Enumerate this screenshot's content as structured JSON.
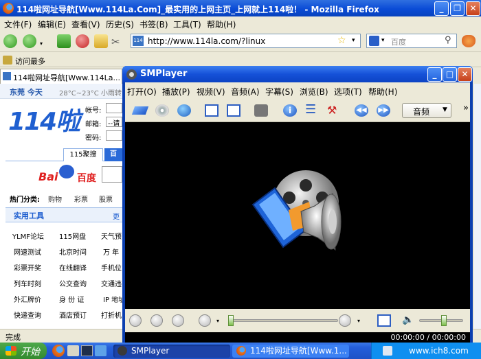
{
  "firefox": {
    "title": "114啦网址导航[Www.114La.Com]_最实用的上网主页_上网就上114啦！ - Mozilla Firefox",
    "menu": [
      "文件(F)",
      "编辑(E)",
      "查看(V)",
      "历史(S)",
      "书签(B)",
      "工具(T)",
      "帮助(H)"
    ],
    "url": "http://www.114la.com/?linux",
    "search_placeholder": "百度",
    "bookmark": "访问最多",
    "tab_title": "114啦网址导航[Www.114La...",
    "status": "完成"
  },
  "webpage": {
    "location": "东莞 今天",
    "weather": "28°C~23°C 小雨转",
    "logo": "114啦",
    "account_label": "帐号:",
    "email_label": "邮箱:",
    "email_value": "--请",
    "password_label": "密码:",
    "search_tab": "115聚搜",
    "search_tab2": "百",
    "baidu_logo": "Bai",
    "baidu_cn": "百度",
    "hot_label": "热门分类:",
    "hot_items": [
      "购物",
      "彩票",
      "股票"
    ],
    "tools_title": "实用工具",
    "tools_more": "更",
    "tools": [
      [
        "YLMF论坛",
        "115网盘",
        "天气预"
      ],
      [
        "网速测试",
        "北京时间",
        "万 年"
      ],
      [
        "彩票开奖",
        "在线翻译",
        "手机位"
      ],
      [
        "列车时刻",
        "公交查询",
        "交通违"
      ],
      [
        "外汇牌价",
        "身 份 证",
        "IP 地址"
      ],
      [
        "快递查询",
        "酒店预订",
        "打折机"
      ]
    ]
  },
  "smplayer": {
    "title": "SMPlayer",
    "menu": [
      "打开(O)",
      "播放(P)",
      "视频(V)",
      "音频(A)",
      "字幕(S)",
      "浏览(B)",
      "选项(T)",
      "帮助(H)"
    ],
    "audio_select": "音频",
    "time": "00:00:00 / 00:00:00",
    "overflow": "»"
  },
  "taskbar": {
    "start": "开始",
    "tasks": [
      "SMPlayer",
      "114啦网址导航[Www.1..."
    ],
    "watermark": "www.ich8.com"
  }
}
